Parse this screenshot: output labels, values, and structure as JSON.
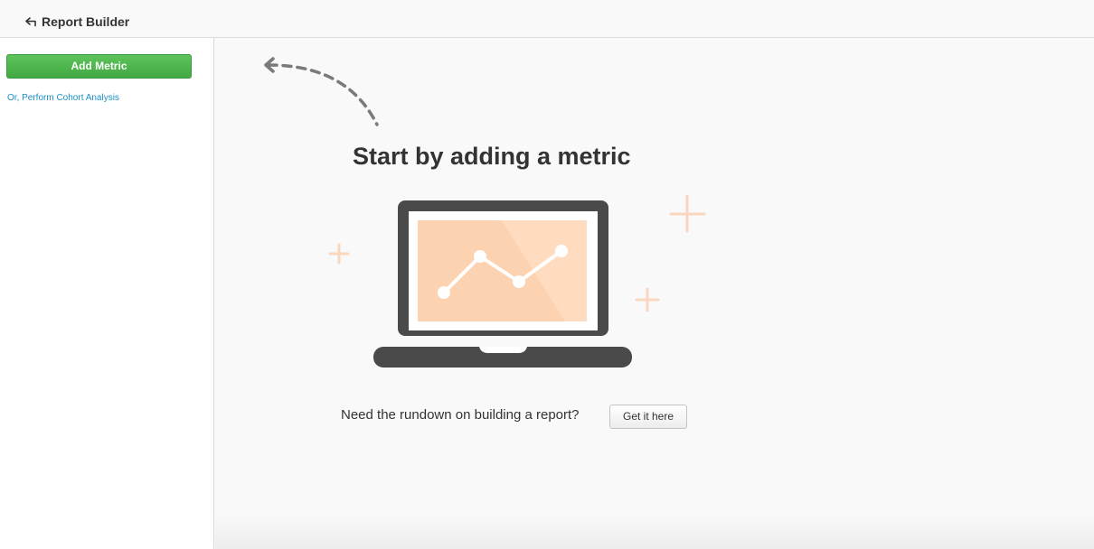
{
  "header": {
    "back_icon": "back-arrow-icon",
    "title": "Report Builder"
  },
  "sidebar": {
    "add_metric_label": "Add Metric",
    "cohort_link_label": "Or, Perform Cohort Analysis"
  },
  "main": {
    "heading": "Start by adding a metric",
    "help_text": "Need the rundown on building a report?",
    "get_it_label": "Get it here",
    "illustration_icon": "laptop-chart-icon",
    "pointer_icon": "dashed-curved-arrow-icon"
  },
  "colors": {
    "primary_button": "#4cb64c",
    "link": "#1a8fc7",
    "laptop": "#4a4a4a",
    "chart_fill": "#fdd2b0",
    "sparkle": "#fbd6be"
  }
}
